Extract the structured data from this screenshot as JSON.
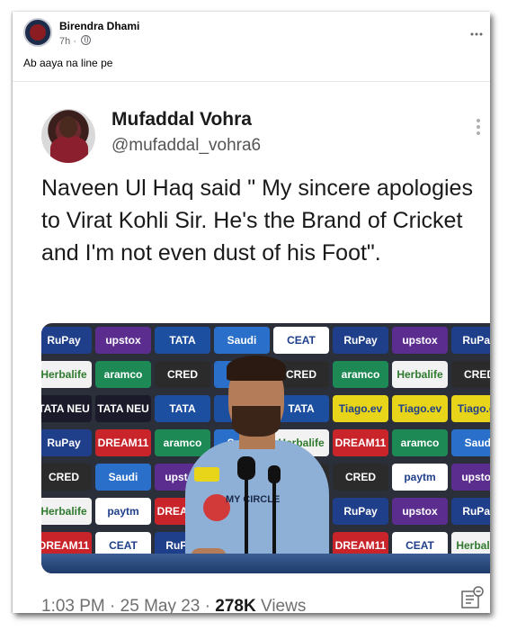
{
  "post": {
    "author": "Birendra Dhami",
    "time": "7h",
    "separator": "·",
    "caption": "Ab aaya na line pe"
  },
  "tweet": {
    "name": "Mufaddal Vohra",
    "handle": "@mufaddal_vohra6",
    "text": "Naveen Ul Haq said \" My sincere apologies to Virat Kohli Sir. He's the Brand of Cricket and I'm not even dust of his Foot\".",
    "time": "1:03 PM",
    "date": "25 May 23",
    "views_count": "278K",
    "views_label": "Views"
  },
  "sponsors": {
    "rupay": "RuPay",
    "upstox": "upstox",
    "tata": "TATA",
    "saudi": "Saudi",
    "ceat": "CEAT",
    "herbalife": "Herbalife",
    "aramco": "aramco",
    "cred": "CRED",
    "tataneu": "TATA NEU",
    "tiago": "Tiago.ev",
    "dream11": "DREAM11",
    "paytm": "paytm",
    "jersey": "MY CIRCLE"
  },
  "colors": {
    "rupay_bg": "#1f3f8a",
    "upstox_bg": "#5b2d8e",
    "tata_bg": "#1d4fa0",
    "saudi_bg": "#2a6fc9",
    "ceat_bg": "#ffffff",
    "herbalife_bg": "#f2f2f2",
    "aramco_bg": "#1d8a55",
    "cred_bg": "#2b2b2b",
    "tataneu_bg": "#1a1a2a",
    "tiago_bg": "#e8d51a",
    "dream11_bg": "#c8242a",
    "paytm_bg": "#ffffff",
    "jersey": "#8fb0d6",
    "table": "#1e3a6a"
  },
  "icons": {
    "post_menu": "ellipsis-icon",
    "tweet_menu": "vertical-ellipsis-icon",
    "audience": "globe-icon",
    "analytics": "analytics-icon"
  }
}
